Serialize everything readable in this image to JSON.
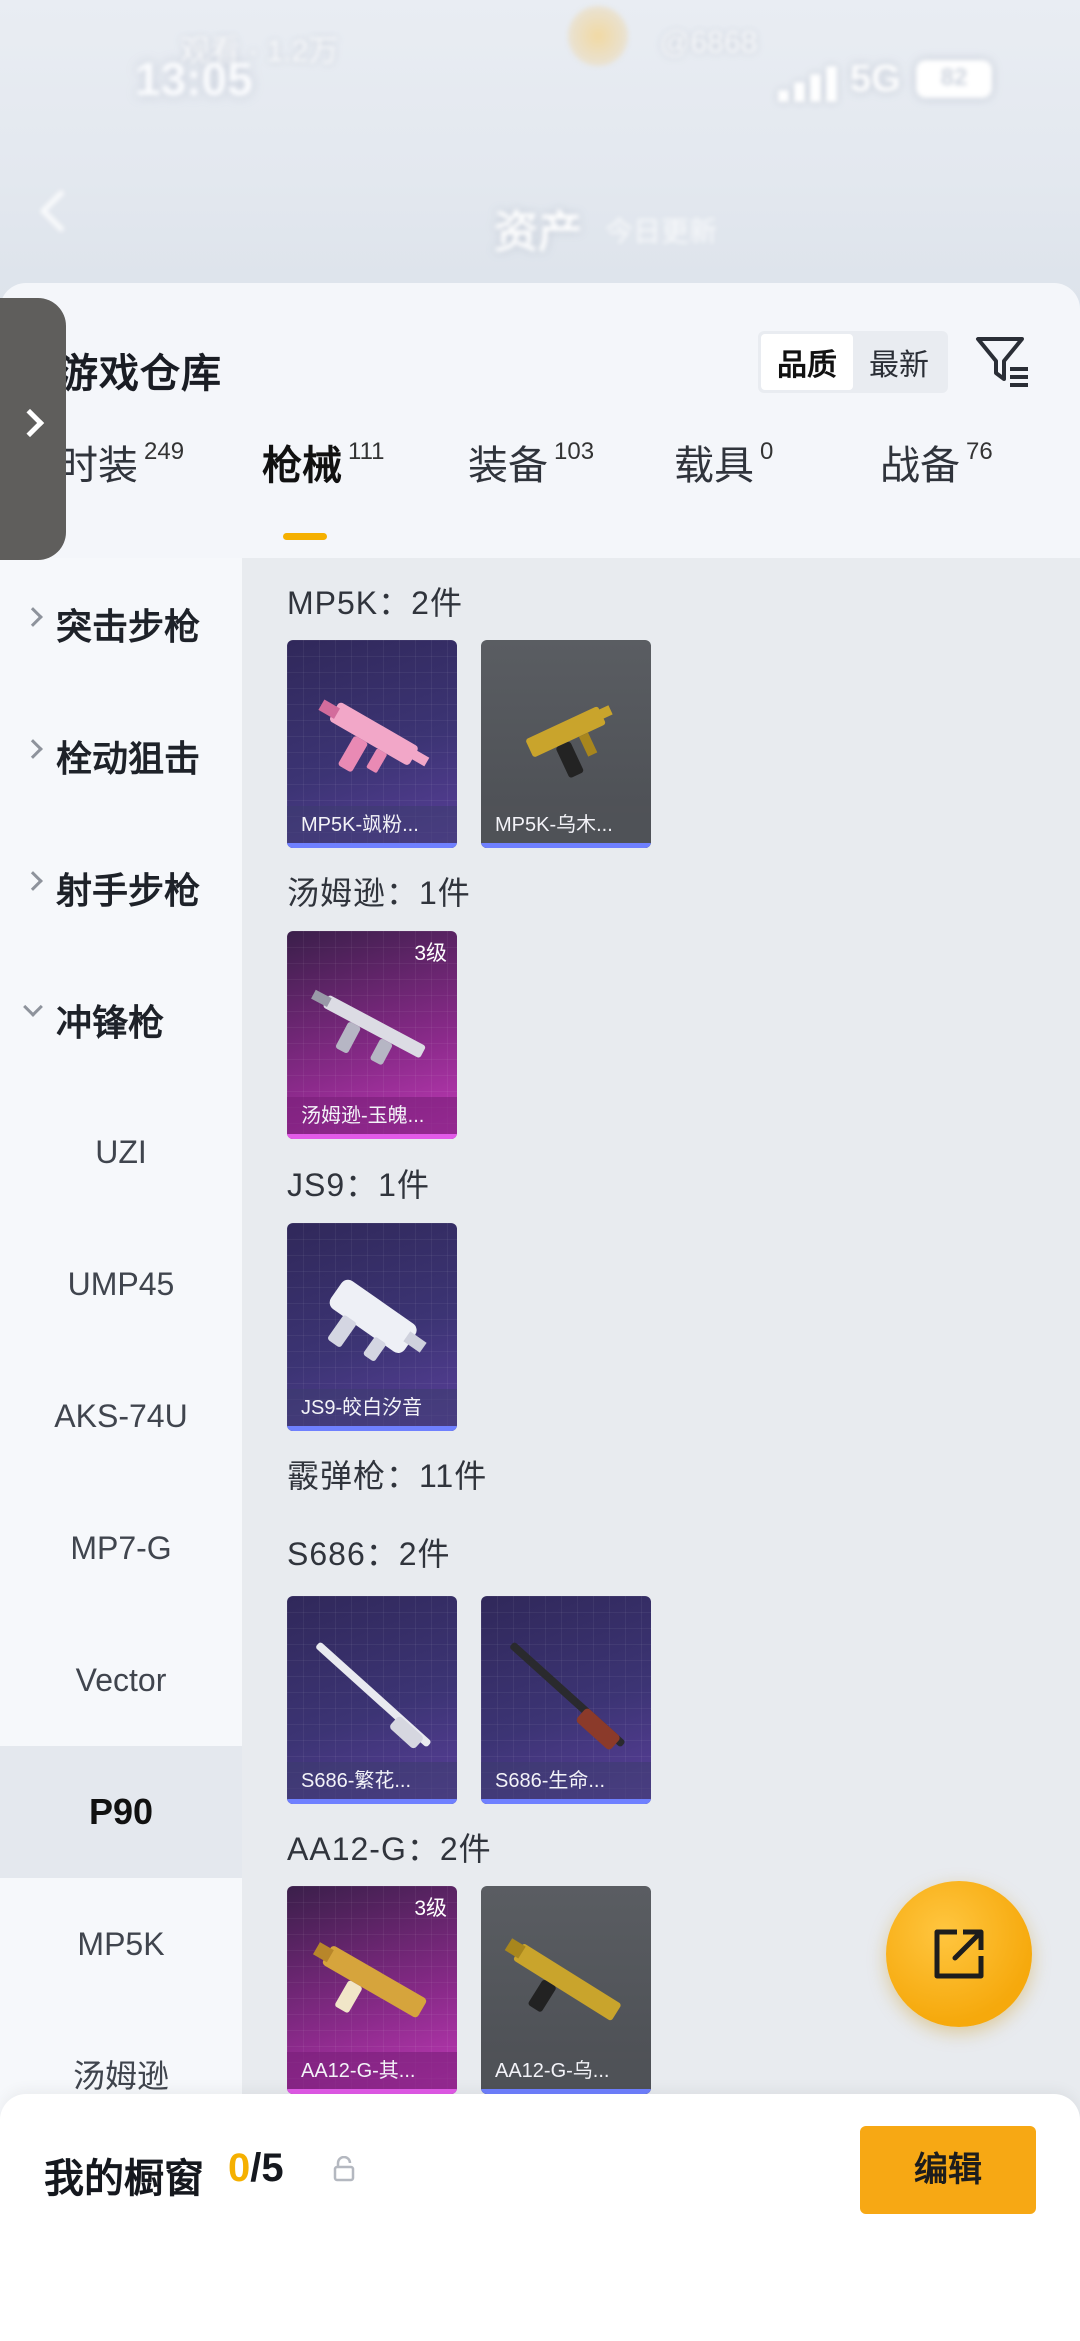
{
  "status_bar": {
    "time": "13:05",
    "network": "5G",
    "battery": "82",
    "ghost_left": "观看 · 1.2万",
    "ghost_right": "@6868"
  },
  "nav": {
    "title": "资产",
    "subtitle": "今日更新"
  },
  "header": {
    "title": "游戏仓库",
    "sort_options": [
      "品质",
      "最新"
    ],
    "sort_active": "品质"
  },
  "tabs": [
    {
      "label": "时装",
      "count": "249"
    },
    {
      "label": "枪械",
      "count": "111"
    },
    {
      "label": "装备",
      "count": "103"
    },
    {
      "label": "载具",
      "count": "0"
    },
    {
      "label": "战备",
      "count": "76"
    }
  ],
  "categories": [
    {
      "label": "突击步枪",
      "expanded": false
    },
    {
      "label": "栓动狙击",
      "expanded": false
    },
    {
      "label": "射手步枪",
      "expanded": false
    },
    {
      "label": "冲锋枪",
      "expanded": true
    }
  ],
  "subcategories": [
    "UZI",
    "UMP45",
    "AKS-74U",
    "MP7-G",
    "Vector",
    "P90",
    "MP5K",
    "汤姆逊"
  ],
  "selected_subcategory": "P90",
  "groups": [
    {
      "title": "MP5K：2件",
      "items": [
        {
          "name": "MP5K-飒粉...",
          "style": "purple",
          "level": ""
        },
        {
          "name": "MP5K-乌木...",
          "style": "gray",
          "level": ""
        }
      ]
    },
    {
      "title": "汤姆逊：1件",
      "items": [
        {
          "name": "汤姆逊-玉魄...",
          "style": "pink",
          "level": "3级"
        }
      ]
    },
    {
      "title": "JS9：1件",
      "items": [
        {
          "name": "JS9-皎白汐音",
          "style": "purple",
          "level": ""
        }
      ]
    },
    {
      "title": "霰弹枪：11件",
      "items": []
    },
    {
      "title": "S686：2件",
      "items": [
        {
          "name": "S686-繁花...",
          "style": "purple",
          "level": ""
        },
        {
          "name": "S686-生命...",
          "style": "purple",
          "level": ""
        }
      ]
    },
    {
      "title": "AA12-G：2件",
      "items": [
        {
          "name": "AA12-G-其...",
          "style": "pink",
          "level": "3级"
        },
        {
          "name": "AA12-G-乌...",
          "style": "gray",
          "level": ""
        }
      ]
    }
  ],
  "showcase": {
    "label": "我的橱窗",
    "current": "0",
    "separator": "/",
    "max": "5",
    "edit_label": "编辑"
  },
  "colors": {
    "accent": "#f5b000",
    "edit_button": "#f7a814",
    "card_purple": "#3c3474",
    "card_pink": "#c23ab8",
    "card_gray": "#4c4f54"
  },
  "icons": [
    "back-chevron-icon",
    "filter-icon",
    "expand-handle-icon",
    "share-icon",
    "lock-icon"
  ]
}
